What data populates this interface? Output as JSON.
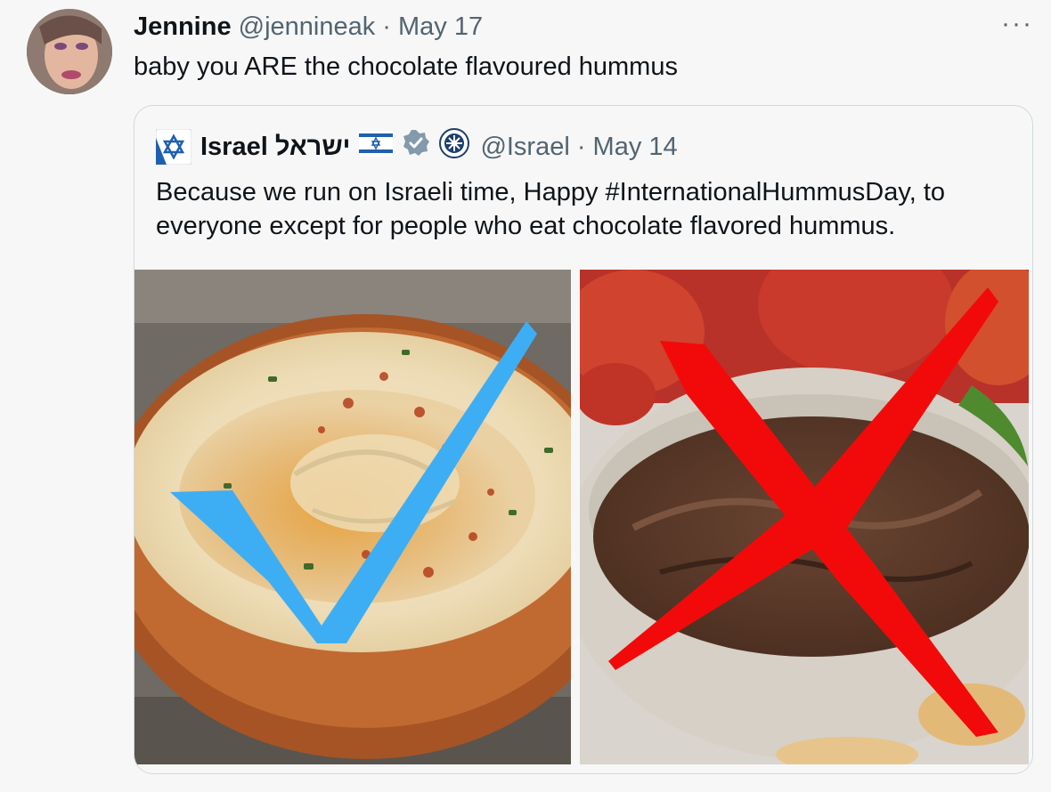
{
  "tweet": {
    "author_name": "Jennine",
    "handle_date": "@jennineak · May 17",
    "text": "baby you ARE the chocolate flavoured hummus",
    "more_label": "···"
  },
  "quote": {
    "author_name": "Israel ישראל",
    "handle_date": "@Israel · May 14",
    "text": "Because we run on Israeli time, Happy #InternationalHummusDay, to everyone except for people who eat chocolate flavored hummus."
  },
  "media": {
    "left_image": "classic-hummus-with-checkmark",
    "right_image": "chocolate-hummus-with-red-x",
    "checkmark_color": "#3eaef4",
    "x_color": "#f20a0a"
  },
  "icons": {
    "quote_avatar": "star-of-david-icon",
    "flag": "israel-flag-icon",
    "verified": "verified-badge-icon",
    "affiliate": "government-seal-icon"
  }
}
